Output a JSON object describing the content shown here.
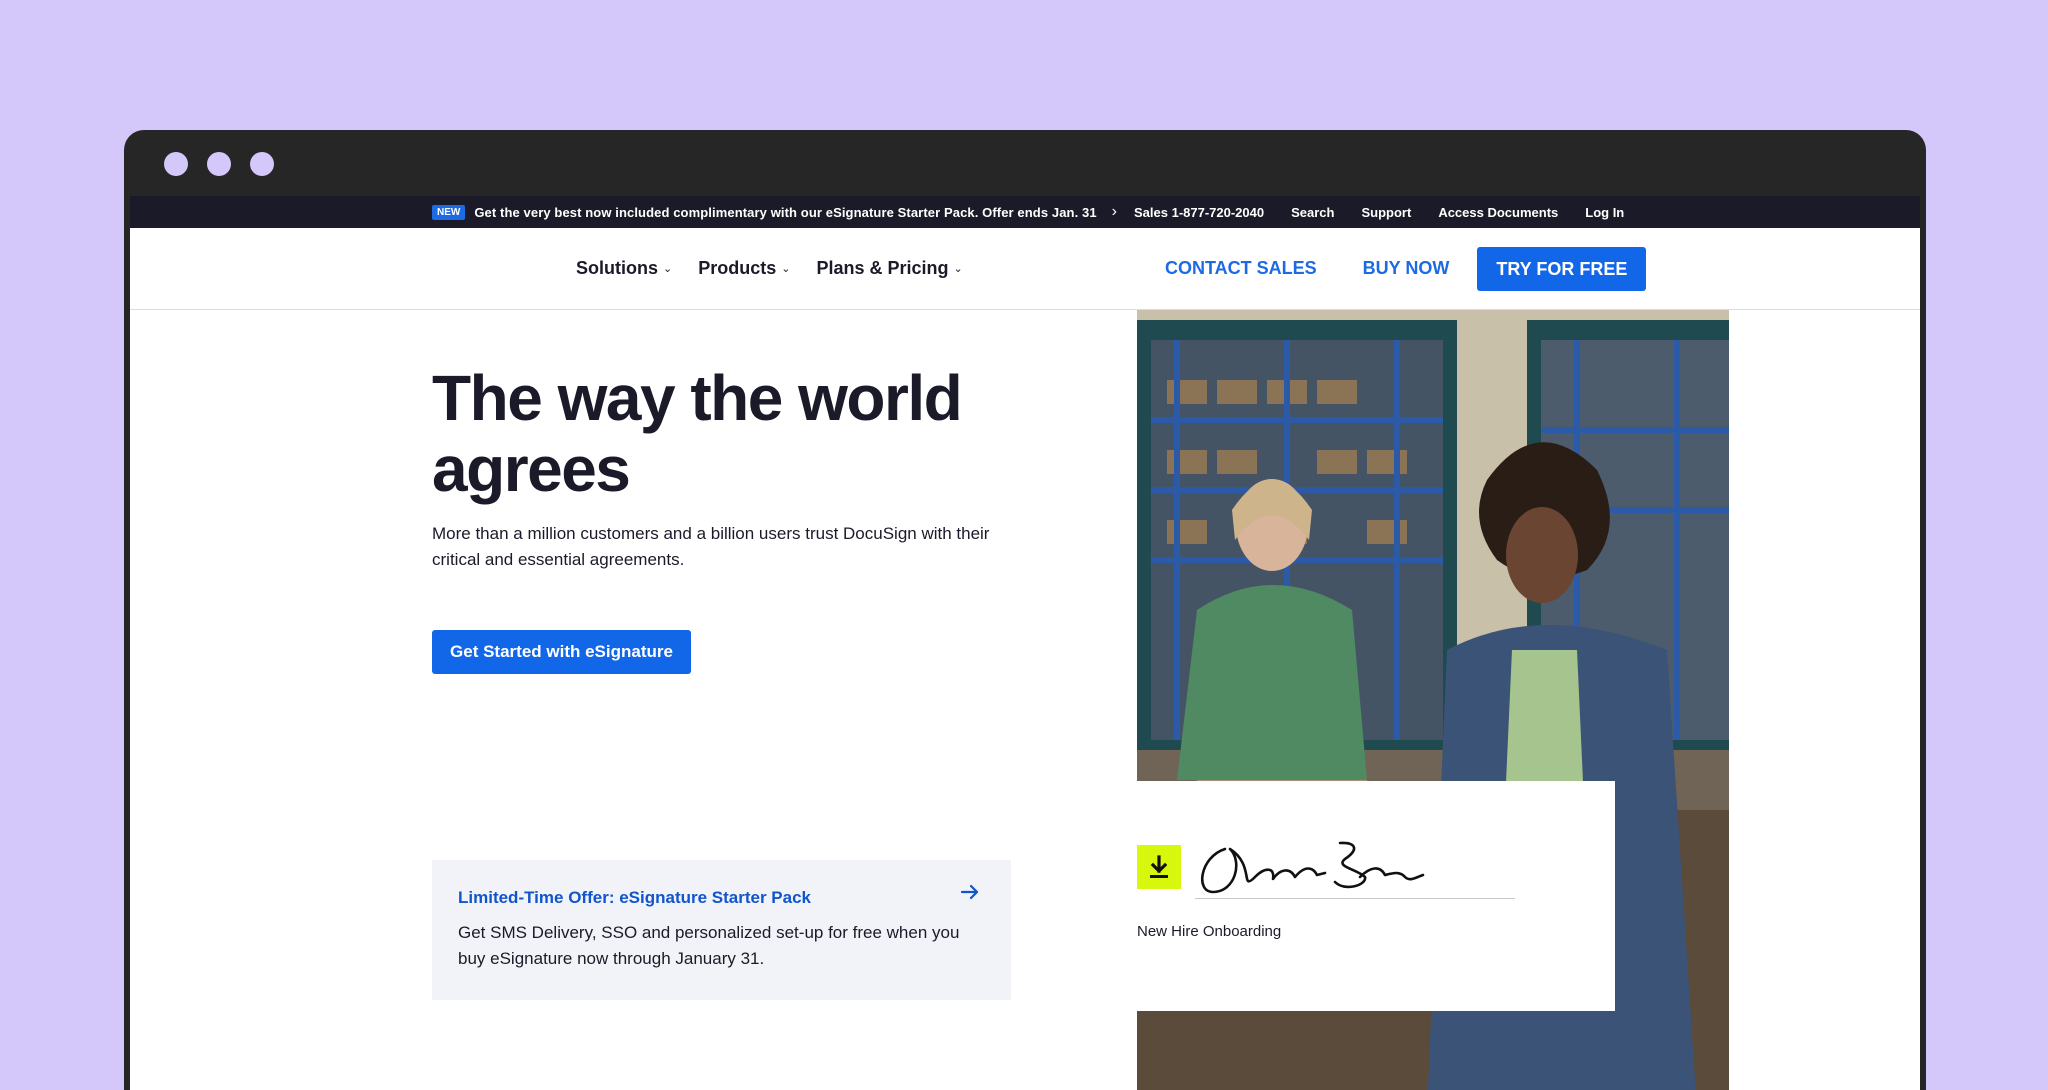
{
  "promo": {
    "badge": "NEW",
    "text": "Get the very best now included complimentary with our eSignature Starter Pack. Offer ends Jan. 31"
  },
  "utility_nav": {
    "sales": "Sales 1-877-720-2040",
    "search": "Search",
    "support": "Support",
    "access": "Access Documents",
    "login": "Log In"
  },
  "main_nav": {
    "items": [
      "Solutions",
      "Products",
      "Plans & Pricing"
    ],
    "contact_sales": "CONTACT SALES",
    "buy_now": "BUY NOW",
    "try_free": "TRY FOR FREE"
  },
  "hero": {
    "title": "The way the world agrees",
    "subtitle": "More than a million customers and a billion users trust DocuSign with their critical and essential agreements.",
    "cta": "Get Started with eSignature"
  },
  "offer": {
    "title": "Limited-Time Offer: eSignature Starter Pack",
    "description": "Get SMS Delivery, SSO and personalized set-up for free when you buy eSignature now through January 31."
  },
  "signature_card": {
    "label": "New Hire Onboarding"
  },
  "colors": {
    "page_bg": "#d4c8fb",
    "accent": "#1167e8",
    "utility_bar": "#1b1a29",
    "download_icon_bg": "#d7f70c"
  }
}
